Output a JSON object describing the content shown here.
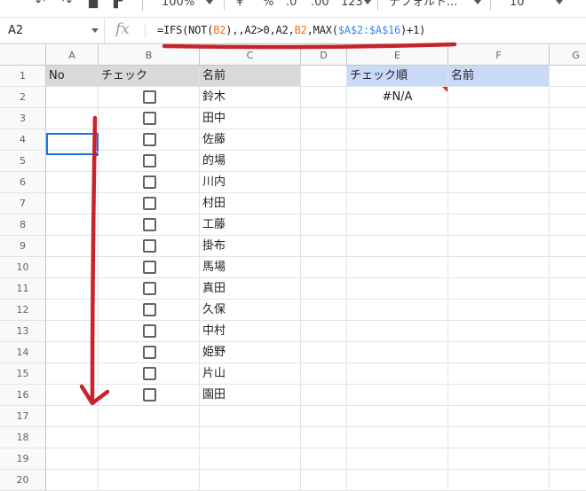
{
  "toolbar": {
    "zoom": "100%",
    "currency": "¥",
    "percent": "%",
    "dec_less": ".0",
    "dec_more": ".00",
    "number_format": "123",
    "font": "デフォルト...",
    "font_size": "10"
  },
  "formula_bar": {
    "cell_ref": "A2",
    "fx_label": "fx",
    "formula_parts": [
      "=IFS(NOT(",
      "B2",
      "),,A2>0,A2,",
      "B2",
      ",MAX(",
      "$A$2:$A$16",
      ")+1)"
    ]
  },
  "columns": [
    "A",
    "B",
    "C",
    "D",
    "E",
    "F",
    "G"
  ],
  "rows": [
    "1",
    "2",
    "3",
    "4",
    "5",
    "6",
    "7",
    "8",
    "9",
    "10",
    "11",
    "12",
    "13",
    "14",
    "15",
    "16",
    "17",
    "18",
    "19",
    "20"
  ],
  "headers": {
    "a1": "No",
    "b1": "チェック",
    "c1": "名前",
    "e1": "チェック順",
    "f1": "名前"
  },
  "e2_value": "#N/A",
  "names": [
    "鈴木",
    "田中",
    "佐藤",
    "的場",
    "川内",
    "村田",
    "工藤",
    "掛布",
    "馬場",
    "真田",
    "久保",
    "中村",
    "姫野",
    "片山",
    "園田"
  ],
  "annotation_color": "#c8232a"
}
